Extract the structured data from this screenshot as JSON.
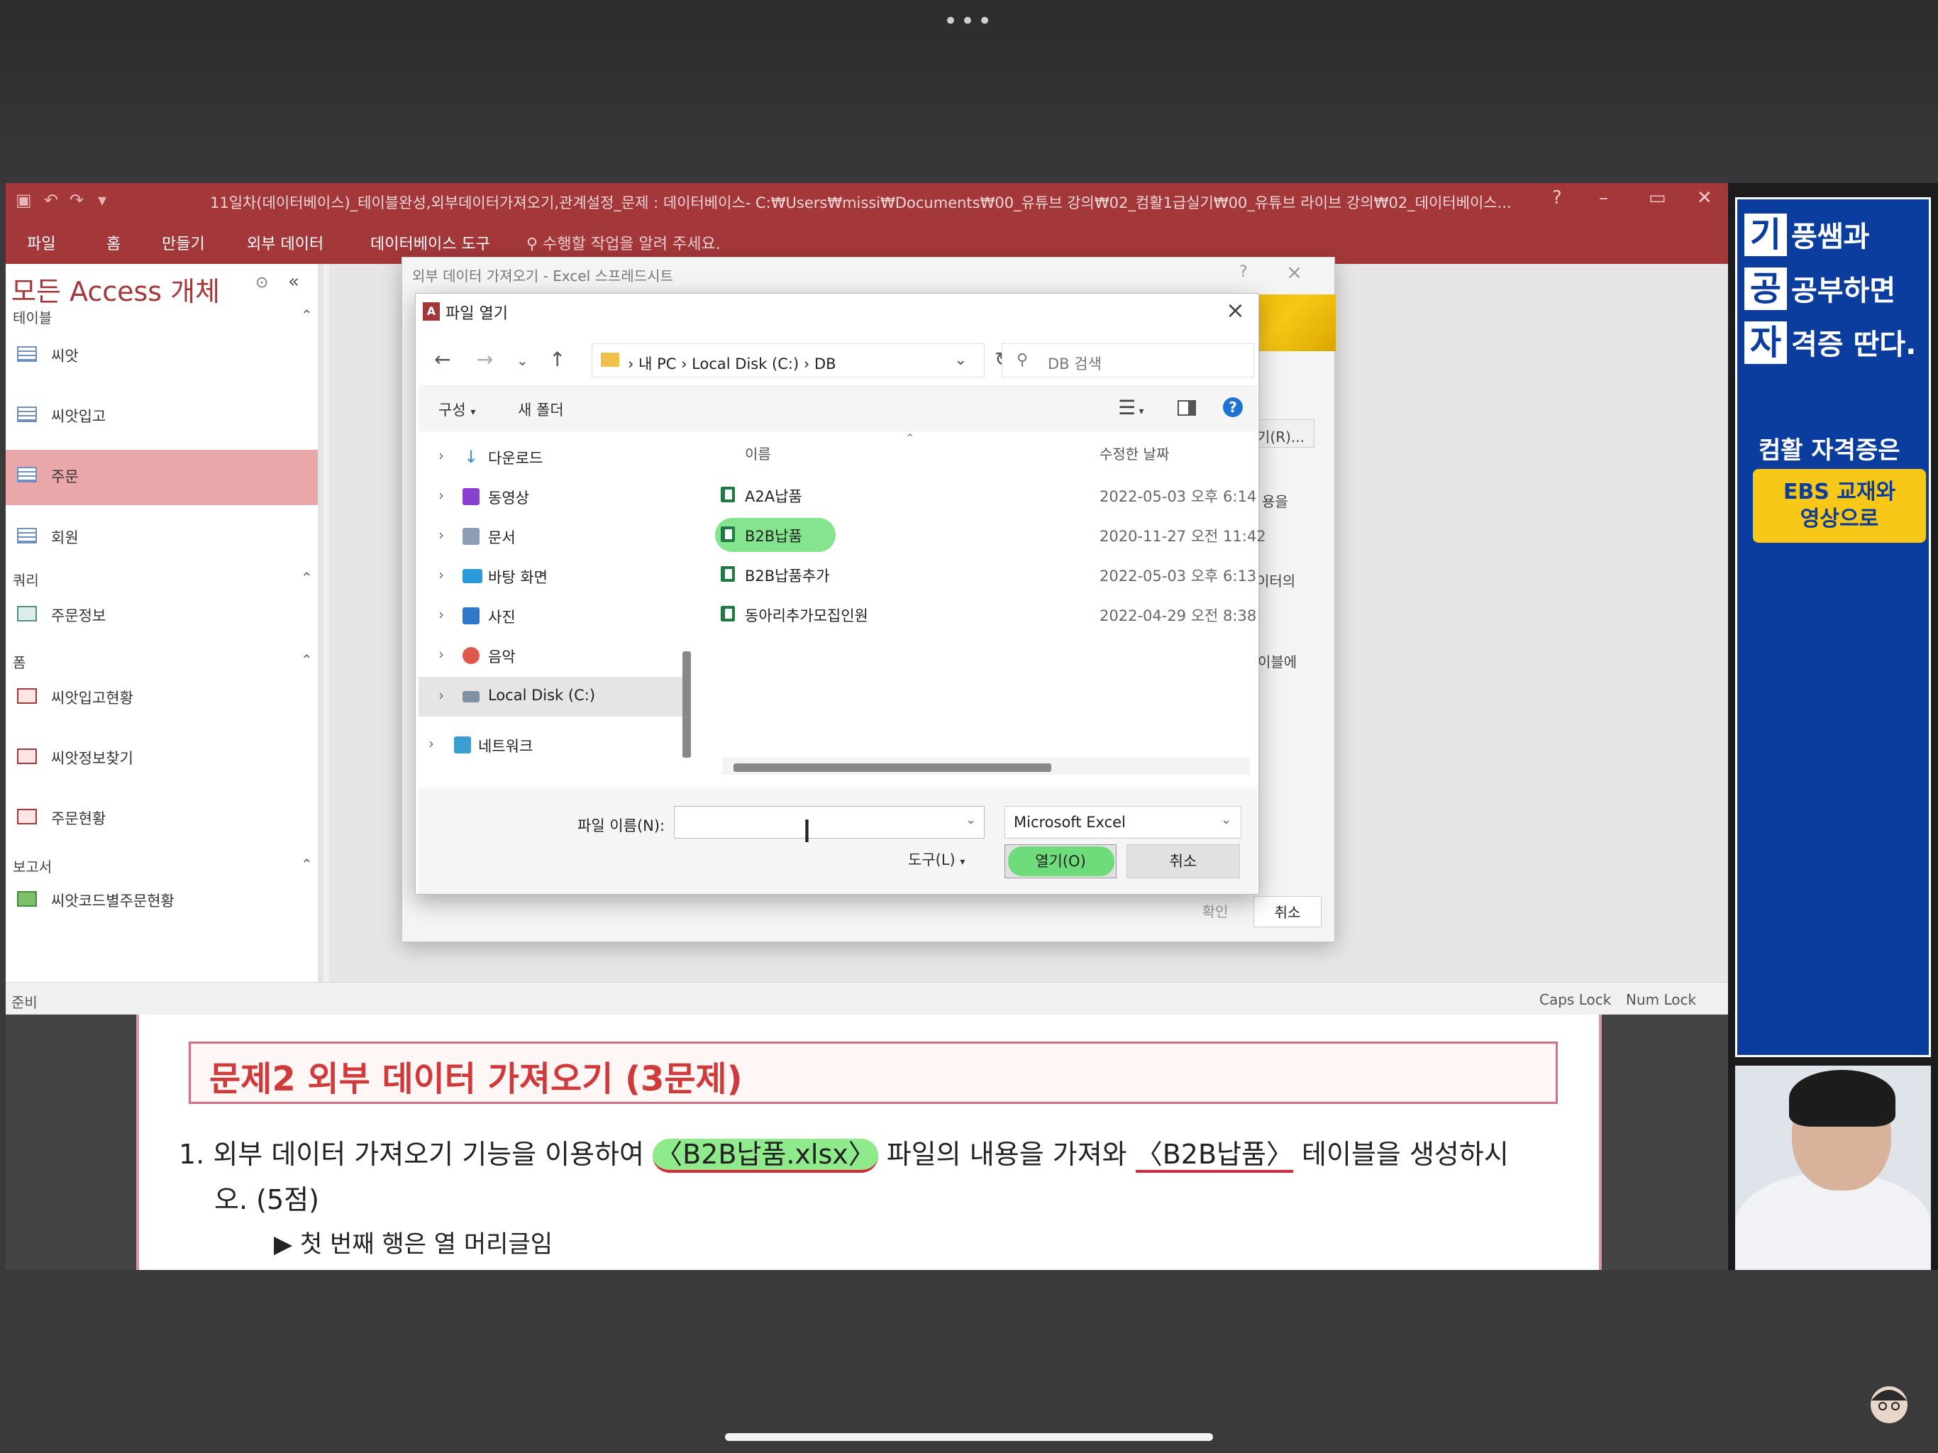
{
  "access": {
    "title": "11일차(데이터베이스)_테이블완성,외부데이터가져오기,관계설정_문제 : 데이터베이스- C:₩Users₩missi₩Documents₩00_유튜브 강의₩02_컴활1급실기₩00_유튜브 라이브 강의₩02_데이터베이스...",
    "ribbon_tabs": [
      "파일",
      "홈",
      "만들기",
      "외부 데이터",
      "데이터베이스 도구"
    ],
    "tell_me": "수행할 작업을 알려 주세요.",
    "nav": {
      "title": "모든 Access 개체",
      "sections": {
        "tables": "테이블",
        "queries": "쿼리",
        "forms": "폼",
        "reports": "보고서"
      },
      "tables": [
        "씨앗",
        "씨앗입고",
        "주문",
        "회원"
      ],
      "queries": [
        "주문정보"
      ],
      "forms": [
        "씨앗입고현황",
        "씨앗정보찾기",
        "주문현황"
      ],
      "reports": [
        "씨앗코드별주문현황"
      ]
    },
    "status": {
      "ready": "준비",
      "caps": "Caps Lock",
      "num": "Num Lock"
    }
  },
  "wizard": {
    "title": "외부 데이터 가져오기 - Excel 스프레드시트",
    "snippets": [
      "기(R)...",
      "용을",
      "이터의",
      "이블에"
    ],
    "ok": "확인",
    "cancel": "취소"
  },
  "file_dialog": {
    "title": "파일 열기",
    "breadcrumb": [
      "내 PC",
      "Local Disk (C:)",
      "DB"
    ],
    "search_placeholder": "DB 검색",
    "organize": "구성",
    "new_folder": "새 폴더",
    "tree": [
      "다운로드",
      "동영상",
      "문서",
      "바탕 화면",
      "사진",
      "음악",
      "Local Disk (C:)",
      "네트워크"
    ],
    "columns": {
      "name": "이름",
      "date": "수정한 날짜"
    },
    "files": [
      {
        "name": "A2A납품",
        "date": "2022-05-03 오후 6:14"
      },
      {
        "name": "B2B납품",
        "date": "2020-11-27 오전 11:42"
      },
      {
        "name": "B2B납품추가",
        "date": "2022-05-03 오후 6:13"
      },
      {
        "name": "동아리추가모집인원",
        "date": "2022-04-29 오전 8:38"
      }
    ],
    "filename_label": "파일 이름(N):",
    "filename_value": "",
    "filetype": "Microsoft Excel",
    "tools": "도구(L)",
    "open": "열기(O)",
    "cancel": "취소"
  },
  "slide": {
    "banner": "문제2 외부 데이터 가져오기 (3문제)",
    "q1_prefix": "1. 외부 데이터 가져오기 기능을 이용하여 ",
    "q1_file": "〈B2B납품.xlsx〉",
    "q1_mid": " 파일의 내용을 가져와 ",
    "q1_table": "〈B2B납품〉",
    "q1_suffix": " 테이블을 생성하시",
    "q1_cont": "오. (5점)",
    "bullet": "▶ 첫 번째 행은 열 머리글임"
  },
  "promo": {
    "line1_big": "기",
    "line1_rest": "풍쌤과",
    "line2_big": "공",
    "line2_rest": "공부하면",
    "line3_big": "자",
    "line3_rest": "격증 딴다.",
    "sub": "컴활 자격증은",
    "badge1": "EBS 교재와",
    "badge2": "영상으로"
  },
  "colors": {
    "access_red": "#a4373a",
    "promo_blue": "#0b3d9e",
    "highlight_green": "#6ee07a"
  }
}
